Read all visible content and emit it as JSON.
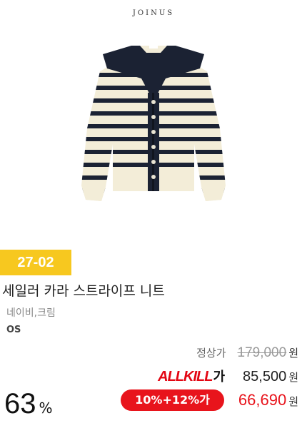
{
  "brand": "JOINUS",
  "product": {
    "image_name": "striped-sailor-collar-cardigan",
    "code": "27-02",
    "title": "세일러 카라 스트라이프 니트",
    "color": "네이비,크림",
    "size": "OS"
  },
  "pricing": {
    "original_label": "정상가",
    "original_price": "179,000",
    "currency": "원",
    "allkill_logo_text": "ALLKILL",
    "allkill_logo_suffix": "가",
    "allkill_price": "85,500",
    "coupon_label": "10%+12%가",
    "final_price": "66,690",
    "discount_value": "63",
    "discount_unit": "%"
  },
  "colors": {
    "badge": "#f7c81f",
    "accent_red": "#e8141c",
    "navy": "#1b2233",
    "cream": "#f3edd8"
  }
}
